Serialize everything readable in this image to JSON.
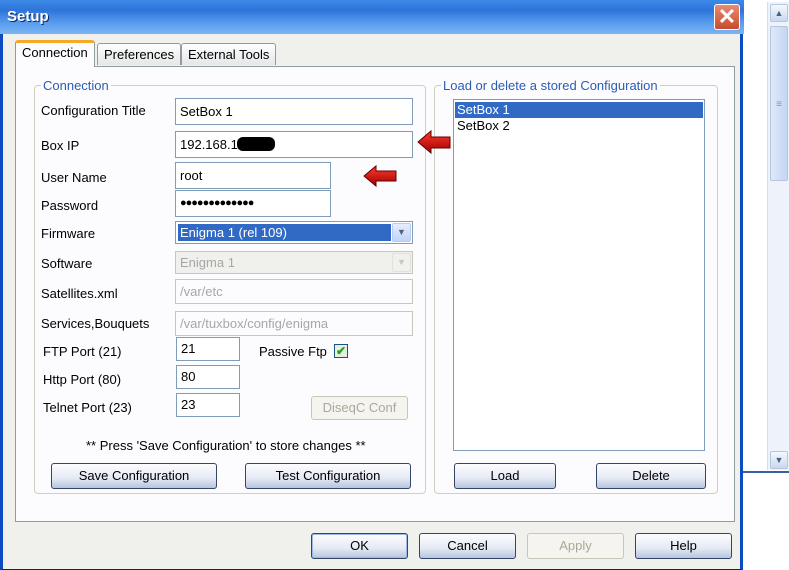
{
  "window": {
    "title": "Setup",
    "close_icon": "close-x-icon"
  },
  "tabs": [
    {
      "label": "Connection",
      "active": true
    },
    {
      "label": "Preferences",
      "active": false
    },
    {
      "label": "External Tools",
      "active": false
    }
  ],
  "connection": {
    "group_label": "Connection",
    "fields": {
      "config_title": {
        "label": "Configuration Title",
        "value": "SetBox 1"
      },
      "box_ip": {
        "label": "Box IP",
        "value": "192.168.1"
      },
      "user_name": {
        "label": "User Name",
        "value": "root"
      },
      "password": {
        "label": "Password",
        "value": "●●●●●●●●●●●●●"
      },
      "firmware": {
        "label": "Firmware",
        "value": "Enigma 1 (rel 109)"
      },
      "software": {
        "label": "Software",
        "value": "Enigma 1"
      },
      "satellites": {
        "label": "Satellites.xml",
        "value": "/var/etc"
      },
      "services": {
        "label": "Services,Bouquets",
        "value": "/var/tuxbox/config/enigma"
      },
      "ftp_port": {
        "label": "FTP Port (21)",
        "value": "21"
      },
      "http_port": {
        "label": "Http Port (80)",
        "value": "80"
      },
      "telnet_port": {
        "label": "Telnet Port (23)",
        "value": "23"
      }
    },
    "passive_ftp": {
      "label": "Passive Ftp",
      "checked": true
    },
    "diseqc_button": "DiseqC Conf",
    "hint": "** Press 'Save Configuration' to store changes **",
    "save_button": "Save Configuration",
    "test_button": "Test Configuration"
  },
  "stored": {
    "group_label": "Load or delete a stored Configuration",
    "items": [
      {
        "label": "SetBox 1",
        "selected": true
      },
      {
        "label": "SetBox 2",
        "selected": false
      }
    ],
    "load_button": "Load",
    "delete_button": "Delete"
  },
  "footer": {
    "ok": "OK",
    "cancel": "Cancel",
    "apply": "Apply",
    "help": "Help"
  },
  "accent_colors": {
    "selection": "#316ac5",
    "title_bar": "#2e74d8",
    "annotation_arrow": "#d40000"
  }
}
